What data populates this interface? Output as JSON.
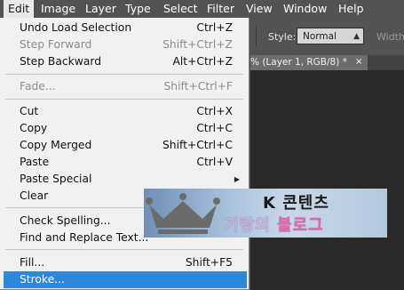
{
  "menubar": {
    "items": [
      "Edit",
      "Image",
      "Layer",
      "Type",
      "Select",
      "Filter",
      "View",
      "Window",
      "Help"
    ],
    "active": "Edit"
  },
  "options_bar": {
    "style_label": "Style:",
    "style_value": "Normal",
    "width_label": "Width:"
  },
  "document_tab": {
    "title": "% (Layer 1, RGB/8) *",
    "close": "×"
  },
  "edit_menu": {
    "items": [
      {
        "label": "Undo Load Selection",
        "shortcut": "Ctrl+Z",
        "enabled": true
      },
      {
        "label": "Step Forward",
        "shortcut": "Shift+Ctrl+Z",
        "enabled": false
      },
      {
        "label": "Step Backward",
        "shortcut": "Alt+Ctrl+Z",
        "enabled": true
      },
      {
        "label": "Fade...",
        "shortcut": "Shift+Ctrl+F",
        "enabled": false
      },
      {
        "label": "Cut",
        "shortcut": "Ctrl+X",
        "enabled": true
      },
      {
        "label": "Copy",
        "shortcut": "Ctrl+C",
        "enabled": true
      },
      {
        "label": "Copy Merged",
        "shortcut": "Shift+Ctrl+C",
        "enabled": true
      },
      {
        "label": "Paste",
        "shortcut": "Ctrl+V",
        "enabled": true
      },
      {
        "label": "Paste Special",
        "shortcut": "",
        "enabled": true,
        "submenu": true
      },
      {
        "label": "Clear",
        "shortcut": "",
        "enabled": true
      },
      {
        "label": "Check Spelling...",
        "shortcut": "",
        "enabled": true
      },
      {
        "label": "Find and Replace Text...",
        "shortcut": "",
        "enabled": true
      },
      {
        "label": "Fill...",
        "shortcut": "Shift+F5",
        "enabled": true
      },
      {
        "label": "Stroke...",
        "shortcut": "",
        "enabled": true,
        "selected": true
      }
    ]
  },
  "watermark": {
    "line1": "K 콘텐츠",
    "line2_a": "기랑의 ",
    "line2_b": "블로그"
  },
  "colors": {
    "menu_bg": "#f1f1f1",
    "highlight": "#2f87d8",
    "chrome": "#535353",
    "workspace": "#292929"
  }
}
